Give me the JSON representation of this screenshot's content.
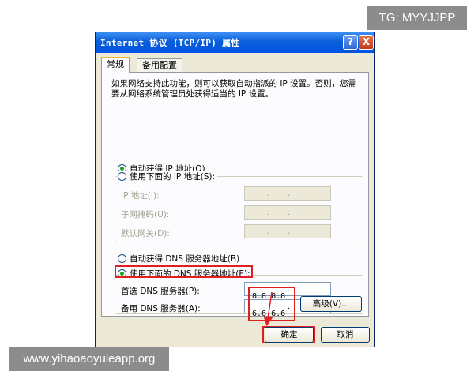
{
  "watermarks": {
    "top_right": "TG: MYYJJPP",
    "bottom_left": "www.yihaoaoyuleapp.org"
  },
  "dialog": {
    "title": "Internet 协议 (TCP/IP) 属性",
    "help_label": "?",
    "close_label": "X",
    "tabs": [
      {
        "label": "常规",
        "active": true
      },
      {
        "label": "备用配置",
        "active": false
      }
    ],
    "description": "如果网络支持此功能，则可以获取自动指派的 IP 设置。否则，您需要从网络系统管理员处获得适当的 IP 设置。",
    "ip": {
      "auto_label": "自动获得 IP 地址(O)",
      "manual_label": "使用下面的 IP 地址(S):",
      "selected": "auto",
      "fields": [
        {
          "label": "IP 地址(I):",
          "value": ""
        },
        {
          "label": "子网掩码(U):",
          "value": ""
        },
        {
          "label": "默认网关(D):",
          "value": ""
        }
      ]
    },
    "dns": {
      "auto_label": "自动获得 DNS 服务器地址(B)",
      "manual_label": "使用下面的 DNS 服务器地址(E):",
      "selected": "manual",
      "preferred_label": "首选 DNS 服务器(P):",
      "alternate_label": "备用 DNS 服务器(A):",
      "preferred_value": "8.8.8.8",
      "alternate_value": "6.6.6.6"
    },
    "advanced_label": "高级(V)...",
    "ok_label": "确定",
    "cancel_label": "取消"
  },
  "colors": {
    "titlebar": "#0054e3",
    "dialog_bg": "#ece9d8",
    "highlight": "#e02020"
  }
}
